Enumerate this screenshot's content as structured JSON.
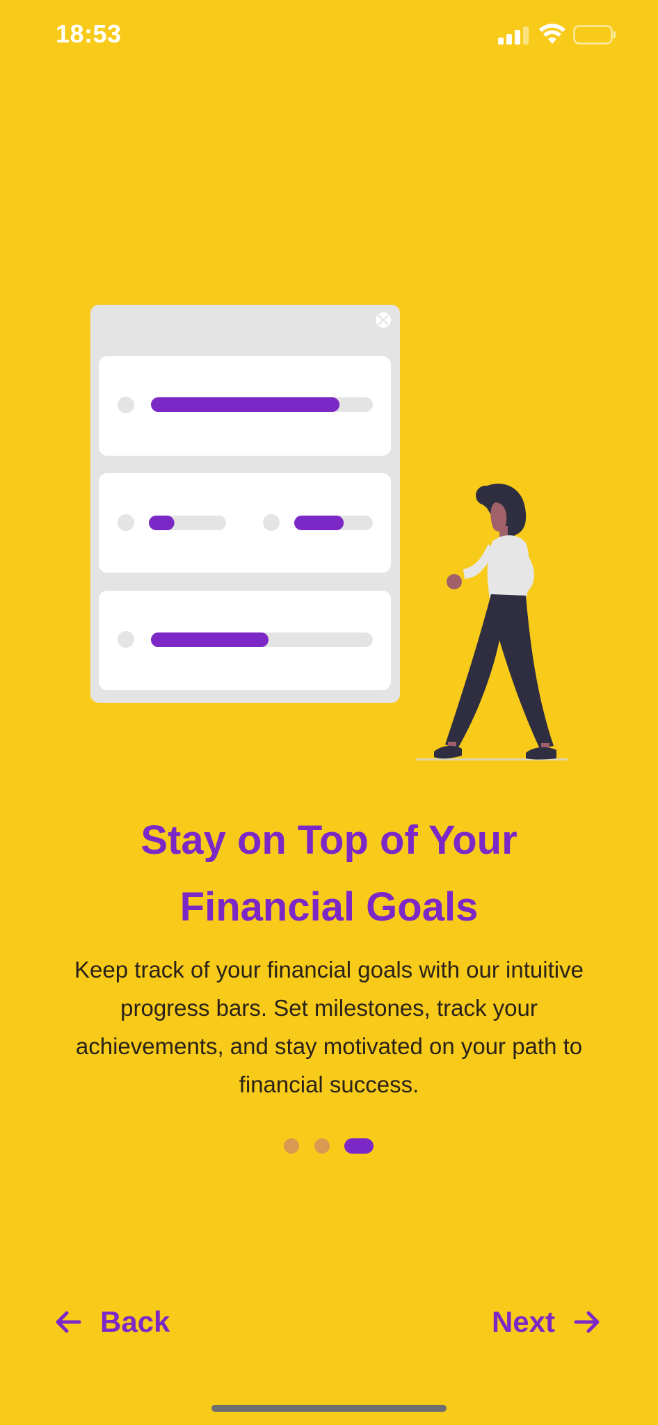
{
  "status_bar": {
    "time": "18:53"
  },
  "onboarding": {
    "title_line1": "Stay on Top of Your",
    "title_line2": "Financial Goals",
    "description": "Keep track of your financial goals with our intuitive progress bars. Set milestones, track your achievements, and stay motivated on your path to financial success.",
    "page_count": 3,
    "current_page": 3
  },
  "illustration": {
    "progress_bars": [
      {
        "name": "goal-1",
        "progress": 0.85
      },
      {
        "name": "goal-2a",
        "progress": 0.33
      },
      {
        "name": "goal-2b",
        "progress": 0.63
      },
      {
        "name": "goal-3",
        "progress": 0.53
      }
    ]
  },
  "navigation": {
    "back_label": "Back",
    "next_label": "Next"
  },
  "colors": {
    "background": "#F8CB1A",
    "accent": "#7C28C7",
    "inactive_dot": "#D89A52",
    "text": "#2a2218"
  }
}
